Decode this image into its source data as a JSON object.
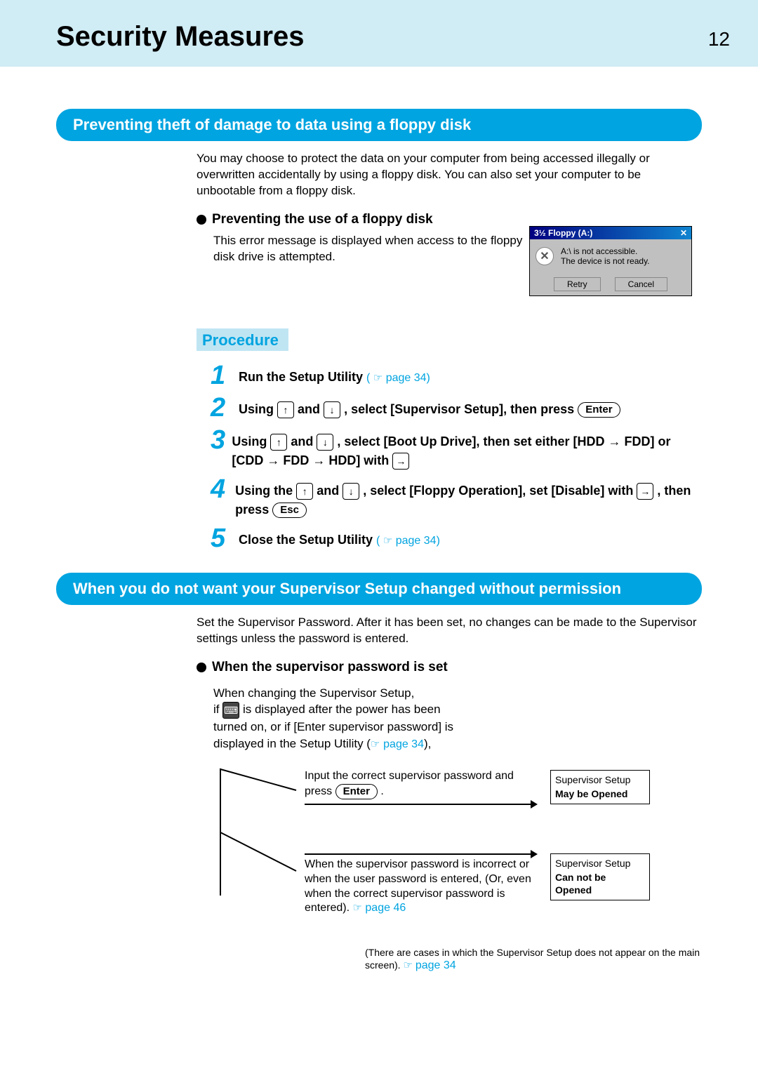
{
  "header": {
    "title": "Security Measures",
    "page_number": "12"
  },
  "section1": {
    "bar": "Preventing theft of damage to data using a floppy disk",
    "intro": "You may choose to protect the data on your computer from being accessed illegally or overwritten accidentally by using a floppy disk. You can also set your computer to be unbootable from a floppy disk.",
    "sub_heading": "Preventing the use of a floppy disk",
    "sub_text": "This error message is displayed when access to the floppy disk drive is attempted.",
    "dialog": {
      "title": "3½ Floppy (A:)",
      "line1": "A:\\ is not accessible.",
      "line2": "The device is not ready.",
      "retry": "Retry",
      "cancel": "Cancel"
    },
    "procedure_label": "Procedure",
    "steps": {
      "s1": {
        "text": "Run the Setup Utility",
        "ref": "page 34"
      },
      "s2": {
        "p1": "Using",
        "p2": "and",
        "p3": ", select [Supervisor Setup], then press",
        "enter": "Enter"
      },
      "s3": {
        "p1": "Using",
        "p2": "and",
        "p3": ", select [Boot Up Drive], then set either [HDD → FDD] or [CDD → FDD → HDD] with"
      },
      "s4": {
        "p1": "Using the",
        "p2": "and",
        "p3": ", select [Floppy Operation], set [Disable] with",
        "p4": ", then press",
        "esc": "Esc"
      },
      "s5": {
        "text": "Close the Setup Utility",
        "ref": "page 34"
      }
    }
  },
  "section2": {
    "bar": "When you do not want your Supervisor Setup changed without permission",
    "intro": "Set the Supervisor Password. After it has been set, no changes can be made to the Supervisor settings unless the password is entered.",
    "sub_heading": "When the supervisor password is set",
    "flow_intro_l1": "When changing the Supervisor Setup,",
    "flow_intro_l2a": "if",
    "flow_intro_l2b": "is displayed after the power has been",
    "flow_intro_l3": "turned on, or if [Enter supervisor password] is",
    "flow_intro_l4a": "displayed in the Setup Utility (",
    "flow_intro_l4_ref": "page 34",
    "flow_intro_l4b": "),",
    "branch1": {
      "text_a": "Input the correct supervisor password and press",
      "enter": "Enter",
      "text_b": ".",
      "box_label": "Supervisor Setup",
      "box_state": "May be Opened"
    },
    "branch2": {
      "text": "When the supervisor password is incorrect or when the user password is entered, (Or, even when the correct supervisor password is entered).",
      "ref": "page 46",
      "box_label": "Supervisor Setup",
      "box_state": "Can not be Opened"
    },
    "footnote_a": "(There are cases in which the Supervisor Setup does not appear on the main screen).",
    "footnote_ref": "page 34"
  }
}
